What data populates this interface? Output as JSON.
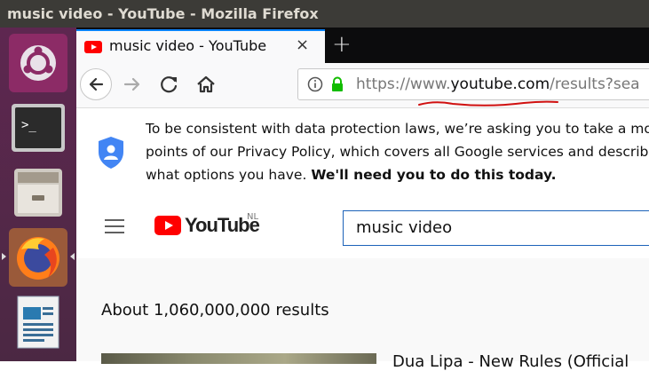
{
  "window": {
    "title": "music video - YouTube - Mozilla Firefox"
  },
  "launcher": {
    "items": [
      {
        "name": "ubuntu-dash-icon"
      },
      {
        "name": "terminal-icon"
      },
      {
        "name": "files-icon"
      },
      {
        "name": "firefox-icon"
      },
      {
        "name": "writer-icon"
      }
    ]
  },
  "tab": {
    "title": "music video - YouTube",
    "close": "×"
  },
  "toolbar": {
    "new_tab": "+"
  },
  "url": {
    "prefix": "https://www.",
    "host": "youtube.com",
    "path": "/results?sea"
  },
  "consent": {
    "line1": "To be consistent with data protection laws, we’re asking you to take a mor",
    "line2": "points of our Privacy Policy, which covers all Google services and describe",
    "line3_plain": "what options you have. ",
    "line3_bold": "We'll need you to do this today."
  },
  "youtube": {
    "logo_text": "YouTube",
    "region": "NL",
    "search_value": "music video",
    "results_count": "About 1,060,000,000 results",
    "first_result_title": "Dua Lipa - New Rules (Official"
  },
  "colors": {
    "accent": "#0a84ff",
    "youtube_red": "#ff0000",
    "launcher": "#5e2750"
  }
}
